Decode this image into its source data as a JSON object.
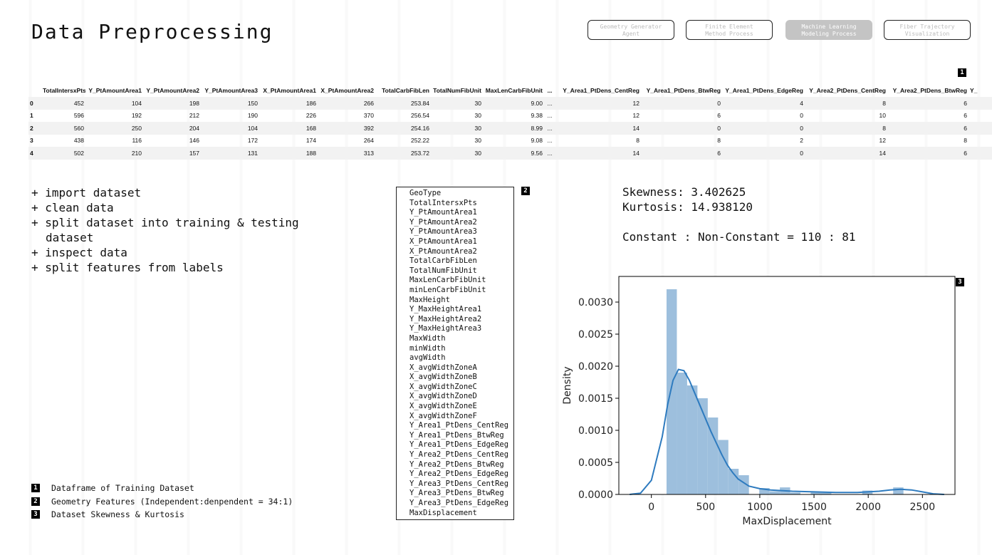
{
  "page_title": "Data Preprocessing",
  "nav": [
    {
      "label": "Geometry Generator\nAgent",
      "active": false
    },
    {
      "label": "Finite Element\nMethod Process",
      "active": false
    },
    {
      "label": "Machine Learning\nModeling Process",
      "active": true
    },
    {
      "label": "Fiber Trajectory\nVisualization",
      "active": false
    }
  ],
  "markers": {
    "m1": "1",
    "m2": "2",
    "m3": "3"
  },
  "dataframe": {
    "columns": [
      "",
      "TotalIntersxPts",
      "Y_PtAmountArea1",
      "Y_PtAmountArea2",
      "Y_PtAmountArea3",
      "X_PtAmountArea1",
      "X_PtAmountArea2",
      "TotalCarbFibLen",
      "TotalNumFibUnit",
      "MaxLenCarbFibUnit",
      "...",
      "Y_Area1_PtDens_CentReg",
      "Y_Area1_PtDens_BtwReg",
      "Y_Area1_PtDens_EdgeReg",
      "Y_Area2_PtDens_CentReg",
      "Y_Area2_PtDens_BtwReg",
      "Y_"
    ],
    "rows": [
      [
        "0",
        "452",
        "104",
        "198",
        "150",
        "186",
        "266",
        "253.84",
        "30",
        "9.00",
        "...",
        "12",
        "0",
        "4",
        "8",
        "6",
        ""
      ],
      [
        "1",
        "596",
        "192",
        "212",
        "190",
        "226",
        "370",
        "256.54",
        "30",
        "9.38",
        "...",
        "12",
        "6",
        "0",
        "10",
        "6",
        ""
      ],
      [
        "2",
        "560",
        "250",
        "204",
        "104",
        "168",
        "392",
        "254.16",
        "30",
        "8.99",
        "...",
        "14",
        "0",
        "0",
        "8",
        "6",
        ""
      ],
      [
        "3",
        "438",
        "116",
        "146",
        "172",
        "174",
        "264",
        "252.22",
        "30",
        "9.08",
        "...",
        "8",
        "8",
        "2",
        "12",
        "8",
        ""
      ],
      [
        "4",
        "502",
        "210",
        "157",
        "131",
        "188",
        "313",
        "253.72",
        "30",
        "9.56",
        "...",
        "14",
        "6",
        "0",
        "14",
        "6",
        ""
      ]
    ]
  },
  "steps": [
    "+ import dataset",
    "+ clean data",
    "+ split dataset into training & testing dataset",
    "+ inspect data",
    "+ split features from labels"
  ],
  "features": [
    "GeoType",
    "TotalIntersxPts",
    "Y_PtAmountArea1",
    "Y_PtAmountArea2",
    "Y_PtAmountArea3",
    "X_PtAmountArea1",
    "X_PtAmountArea2",
    "TotalCarbFibLen",
    "TotalNumFibUnit",
    "MaxLenCarbFibUnit",
    "minLenCarbFibUnit",
    "MaxHeight",
    "Y_MaxHeightArea1",
    "Y_MaxHeightArea2",
    "Y_MaxHeightArea3",
    "MaxWidth",
    "minWidth",
    "avgWidth",
    "X_avgWidthZoneA",
    "X_avgWidthZoneB",
    "X_avgWidthZoneC",
    "X_avgWidthZoneD",
    "X_avgWidthZoneE",
    "X_avgWidthZoneF",
    "Y_Area1_PtDens_CentReg",
    "Y_Area1_PtDens_BtwReg",
    "Y_Area1_PtDens_EdgeReg",
    "Y_Area2_PtDens_CentReg",
    "Y_Area2_PtDens_BtwReg",
    "Y_Area2_PtDens_EdgeReg",
    "Y_Area3_PtDens_CentReg",
    "Y_Area3_PtDens_BtwReg",
    "Y_Area3_PtDens_EdgeReg",
    "MaxDisplacement"
  ],
  "stats": {
    "skewness": "Skewness: 3.402625",
    "kurtosis": "Kurtosis: 14.938120",
    "ratio": "Constant : Non-Constant = 110 : 81"
  },
  "legend": [
    {
      "num": "1",
      "text": "Dataframe of Training Dataset"
    },
    {
      "num": "2",
      "text": "Geometry Features (Independent:denpendent = 34:1)"
    },
    {
      "num": "3",
      "text": "Dataset Skewness & Kurtosis"
    }
  ],
  "colors": {
    "bar": "#9dbfdd",
    "kde": "#2e7bbf"
  },
  "chart_data": {
    "type": "bar",
    "xlabel": "MaxDisplacement",
    "ylabel": "Density",
    "xlim": [
      -300,
      2800
    ],
    "ylim": [
      0,
      0.0034
    ],
    "xticks": [
      0,
      500,
      1000,
      1500,
      2000,
      2500
    ],
    "yticks": [
      0.0,
      0.0005,
      0.001,
      0.0015,
      0.002,
      0.0025,
      0.003
    ],
    "ytick_labels": [
      "0.0000",
      "0.0005",
      "0.0010",
      "0.0015",
      "0.0020",
      "0.0025",
      "0.0030"
    ],
    "bins": [
      {
        "x0": 140,
        "x1": 235,
        "density": 0.0032
      },
      {
        "x0": 235,
        "x1": 330,
        "density": 0.0019
      },
      {
        "x0": 330,
        "x1": 425,
        "density": 0.0017
      },
      {
        "x0": 425,
        "x1": 520,
        "density": 0.0015
      },
      {
        "x0": 520,
        "x1": 615,
        "density": 0.0012
      },
      {
        "x0": 615,
        "x1": 710,
        "density": 0.00085
      },
      {
        "x0": 710,
        "x1": 805,
        "density": 0.0004
      },
      {
        "x0": 805,
        "x1": 900,
        "density": 0.0003
      },
      {
        "x0": 900,
        "x1": 995,
        "density": 0.0
      },
      {
        "x0": 995,
        "x1": 1090,
        "density": 0.0001
      },
      {
        "x0": 1090,
        "x1": 1185,
        "density": 5e-05
      },
      {
        "x0": 1185,
        "x1": 1280,
        "density": 0.00011
      },
      {
        "x0": 1280,
        "x1": 1375,
        "density": 3e-05
      },
      {
        "x0": 1375,
        "x1": 1470,
        "density": 0.0
      },
      {
        "x0": 1470,
        "x1": 1565,
        "density": 4e-05
      },
      {
        "x0": 1565,
        "x1": 1660,
        "density": 4e-05
      },
      {
        "x0": 1660,
        "x1": 1755,
        "density": 0.0
      },
      {
        "x0": 1755,
        "x1": 1850,
        "density": 0.0
      },
      {
        "x0": 1850,
        "x1": 1945,
        "density": 0.0
      },
      {
        "x0": 1945,
        "x1": 2040,
        "density": 6e-05
      },
      {
        "x0": 2040,
        "x1": 2135,
        "density": 0.0
      },
      {
        "x0": 2135,
        "x1": 2230,
        "density": 0.0
      },
      {
        "x0": 2230,
        "x1": 2325,
        "density": 0.00011
      },
      {
        "x0": 2325,
        "x1": 2420,
        "density": 0.0
      }
    ],
    "kde": {
      "x": [
        -200,
        -100,
        0,
        100,
        150,
        200,
        250,
        300,
        350,
        400,
        450,
        500,
        550,
        600,
        650,
        700,
        750,
        800,
        900,
        1000,
        1100,
        1200,
        1300,
        1500,
        1700,
        1900,
        2000,
        2100,
        2200,
        2300,
        2400,
        2500,
        2600,
        2700
      ],
      "y": [
        0.0,
        2e-05,
        0.00022,
        0.0009,
        0.0014,
        0.00178,
        0.00195,
        0.00193,
        0.00178,
        0.00158,
        0.00138,
        0.00118,
        0.00098,
        0.0008,
        0.00062,
        0.00046,
        0.00034,
        0.00024,
        0.00013,
        9e-05,
        7e-05,
        6e-05,
        5e-05,
        4e-05,
        3e-05,
        3e-05,
        4e-05,
        5e-05,
        7e-05,
        8e-05,
        7e-05,
        4e-05,
        1e-05,
        0.0
      ]
    }
  }
}
